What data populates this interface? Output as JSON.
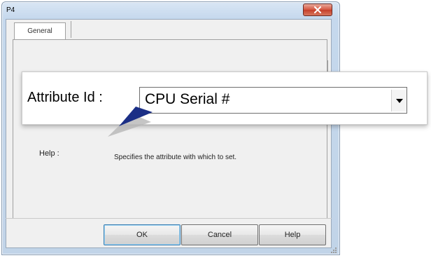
{
  "window": {
    "title": "P4"
  },
  "tabs": [
    {
      "label": "General"
    }
  ],
  "callout": {
    "label": "Attribute Id :",
    "select_value": "CPU Serial #"
  },
  "help": {
    "label": "Help :",
    "text": "Specifies the attribute with which to set."
  },
  "buttons": {
    "ok": "OK",
    "cancel": "Cancel",
    "help": "Help"
  },
  "icons": {
    "close": "close-icon",
    "dropdown": "chevron-down-icon",
    "resize": "resize-grip-icon",
    "pointer": "callout-arrow-icon"
  },
  "colors": {
    "close_button": "#d4553f",
    "pointer_arrow": "#1b2f86",
    "default_button_border": "#3c7fb1"
  }
}
